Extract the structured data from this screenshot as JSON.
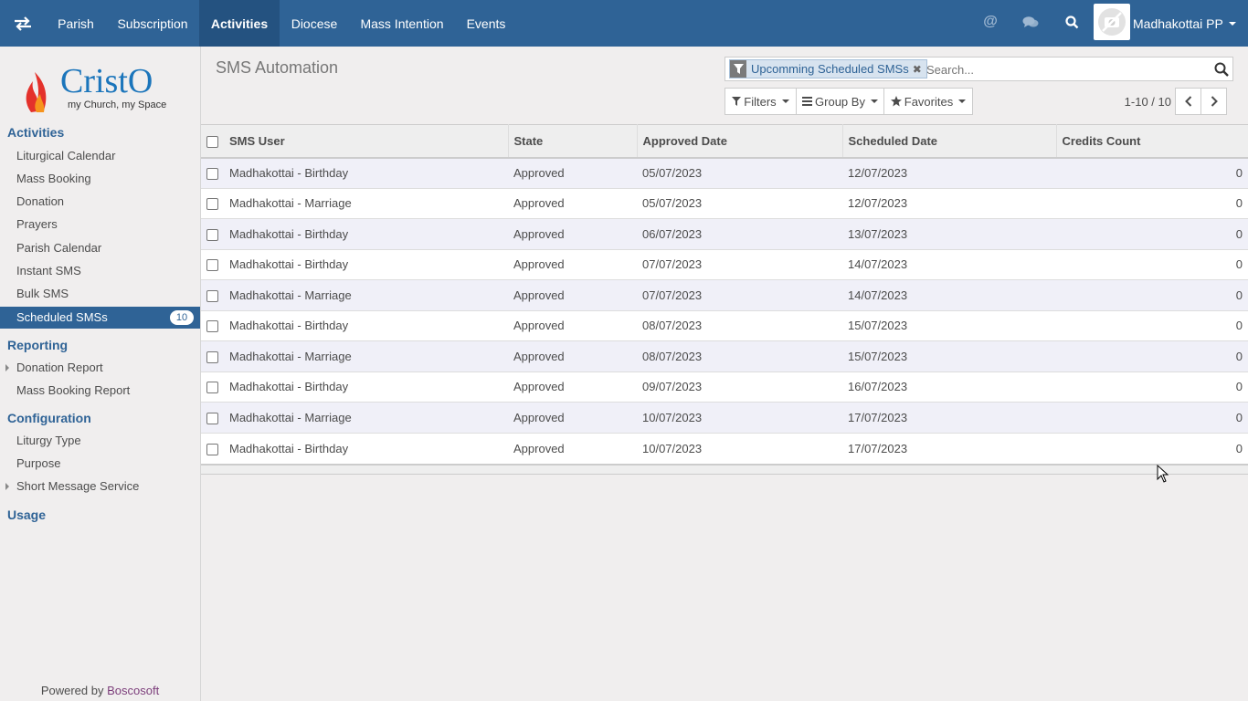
{
  "topbar": {
    "menus": [
      "Parish",
      "Subscription",
      "Activities",
      "Diocese",
      "Mass Intention",
      "Events"
    ],
    "active_menu": "Activities",
    "user_name": "Madhakottai PP",
    "icons": [
      "app-switch-icon",
      "mention-icon",
      "chat-icon",
      "search-icon"
    ]
  },
  "sidebar": {
    "logo_text": "CristO",
    "logo_tagline": "my Church, my Space",
    "sections": {
      "activities": "Activities",
      "reporting": "Reporting",
      "configuration": "Configuration",
      "usage": "Usage"
    },
    "activities_items": [
      "Liturgical Calendar",
      "Mass Booking",
      "Donation",
      "Prayers",
      "Parish Calendar",
      "Instant SMS",
      "Bulk SMS"
    ],
    "active_item": "Scheduled SMSs",
    "active_item_count": "10",
    "reporting_items": [
      "Donation Report",
      "Mass Booking Report"
    ],
    "configuration_items": [
      "Liturgy Type",
      "Purpose",
      "Short Message Service"
    ],
    "powered_prefix": "Powered by",
    "powered_brand": "Boscosoft"
  },
  "control_panel": {
    "title": "SMS Automation",
    "facet_label": "Upcomming Scheduled SMSs",
    "search_placeholder": "Search...",
    "filters_label": "Filters",
    "group_by_label": "Group By",
    "favorites_label": "Favorites",
    "pager_value": "1-10 / 10"
  },
  "table": {
    "columns": [
      "SMS User",
      "State",
      "Approved Date",
      "Scheduled Date",
      "Credits Count"
    ],
    "rows": [
      {
        "user": "Madhakottai - Birthday",
        "state": "Approved",
        "approved": "05/07/2023",
        "scheduled": "12/07/2023",
        "credits": "0"
      },
      {
        "user": "Madhakottai - Marriage",
        "state": "Approved",
        "approved": "05/07/2023",
        "scheduled": "12/07/2023",
        "credits": "0"
      },
      {
        "user": "Madhakottai - Birthday",
        "state": "Approved",
        "approved": "06/07/2023",
        "scheduled": "13/07/2023",
        "credits": "0"
      },
      {
        "user": "Madhakottai - Birthday",
        "state": "Approved",
        "approved": "07/07/2023",
        "scheduled": "14/07/2023",
        "credits": "0"
      },
      {
        "user": "Madhakottai - Marriage",
        "state": "Approved",
        "approved": "07/07/2023",
        "scheduled": "14/07/2023",
        "credits": "0"
      },
      {
        "user": "Madhakottai - Birthday",
        "state": "Approved",
        "approved": "08/07/2023",
        "scheduled": "15/07/2023",
        "credits": "0"
      },
      {
        "user": "Madhakottai - Marriage",
        "state": "Approved",
        "approved": "08/07/2023",
        "scheduled": "15/07/2023",
        "credits": "0"
      },
      {
        "user": "Madhakottai - Birthday",
        "state": "Approved",
        "approved": "09/07/2023",
        "scheduled": "16/07/2023",
        "credits": "0"
      },
      {
        "user": "Madhakottai - Marriage",
        "state": "Approved",
        "approved": "10/07/2023",
        "scheduled": "17/07/2023",
        "credits": "0"
      },
      {
        "user": "Madhakottai - Birthday",
        "state": "Approved",
        "approved": "10/07/2023",
        "scheduled": "17/07/2023",
        "credits": "0"
      }
    ]
  },
  "colors": {
    "brand": "#2f6396",
    "brand_dark": "#245280",
    "logo_red": "#e4312b",
    "logo_blue": "#1b75bb",
    "powered_brand": "#7c3e7b"
  }
}
